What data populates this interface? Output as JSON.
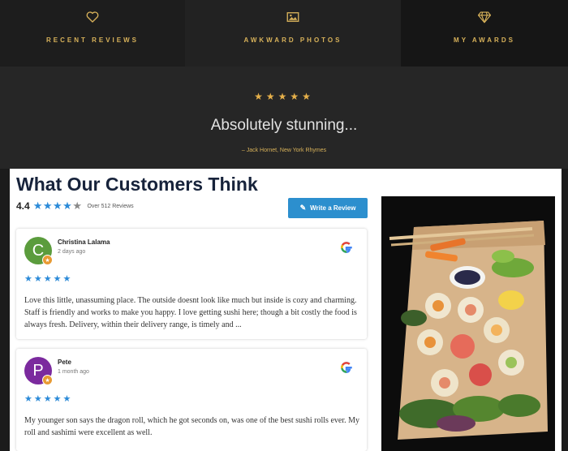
{
  "nav": {
    "items": [
      {
        "label": "RECENT REVIEWS",
        "icon": "heart-icon"
      },
      {
        "label": "AWKWARD PHOTOS",
        "icon": "image-icon"
      },
      {
        "label": "MY AWARDS",
        "icon": "diamond-icon"
      }
    ]
  },
  "testimonial": {
    "stars": "★★★★★",
    "quote": "Absolutely stunning...",
    "author": "– Jack Hornet, New York Rhymes"
  },
  "widget": {
    "heading": "What Our Customers Think",
    "rating": "4.4",
    "stars_filled": 4,
    "stars_total": 5,
    "count_text": "Over 512 Reviews",
    "write_button": "Write a Review",
    "write_icon": "pencil-icon",
    "photo_icon": "sushi-platter-photo",
    "reviews": [
      {
        "avatar_letter": "C",
        "avatar_color": "#5b9c3d",
        "name": "Christina Lalama",
        "date": "2 days ago",
        "stars": "★★★★★",
        "text": "Love this little, unassuming place. The outside doesnt look like much but inside is cozy and charming. Staff is friendly and works to make you happy. I love getting sushi here; though a bit costly the food is always fresh. Delivery, within their delivery range, is timely and ...",
        "source_icon": "google-icon"
      },
      {
        "avatar_letter": "P",
        "avatar_color": "#7b2a9e",
        "name": "Pete",
        "date": "1 month ago",
        "stars": "★★★★★",
        "text": "My younger son says the dragon roll, which he got seconds on, was one of the best sushi rolls ever. My roll and sashimi were excellent as well.",
        "source_icon": "google-icon"
      }
    ]
  },
  "colors": {
    "gold": "#d8b25a",
    "star_blue": "#2b8ad8",
    "button_blue": "#2c8fce",
    "heading_navy": "#17233b"
  }
}
